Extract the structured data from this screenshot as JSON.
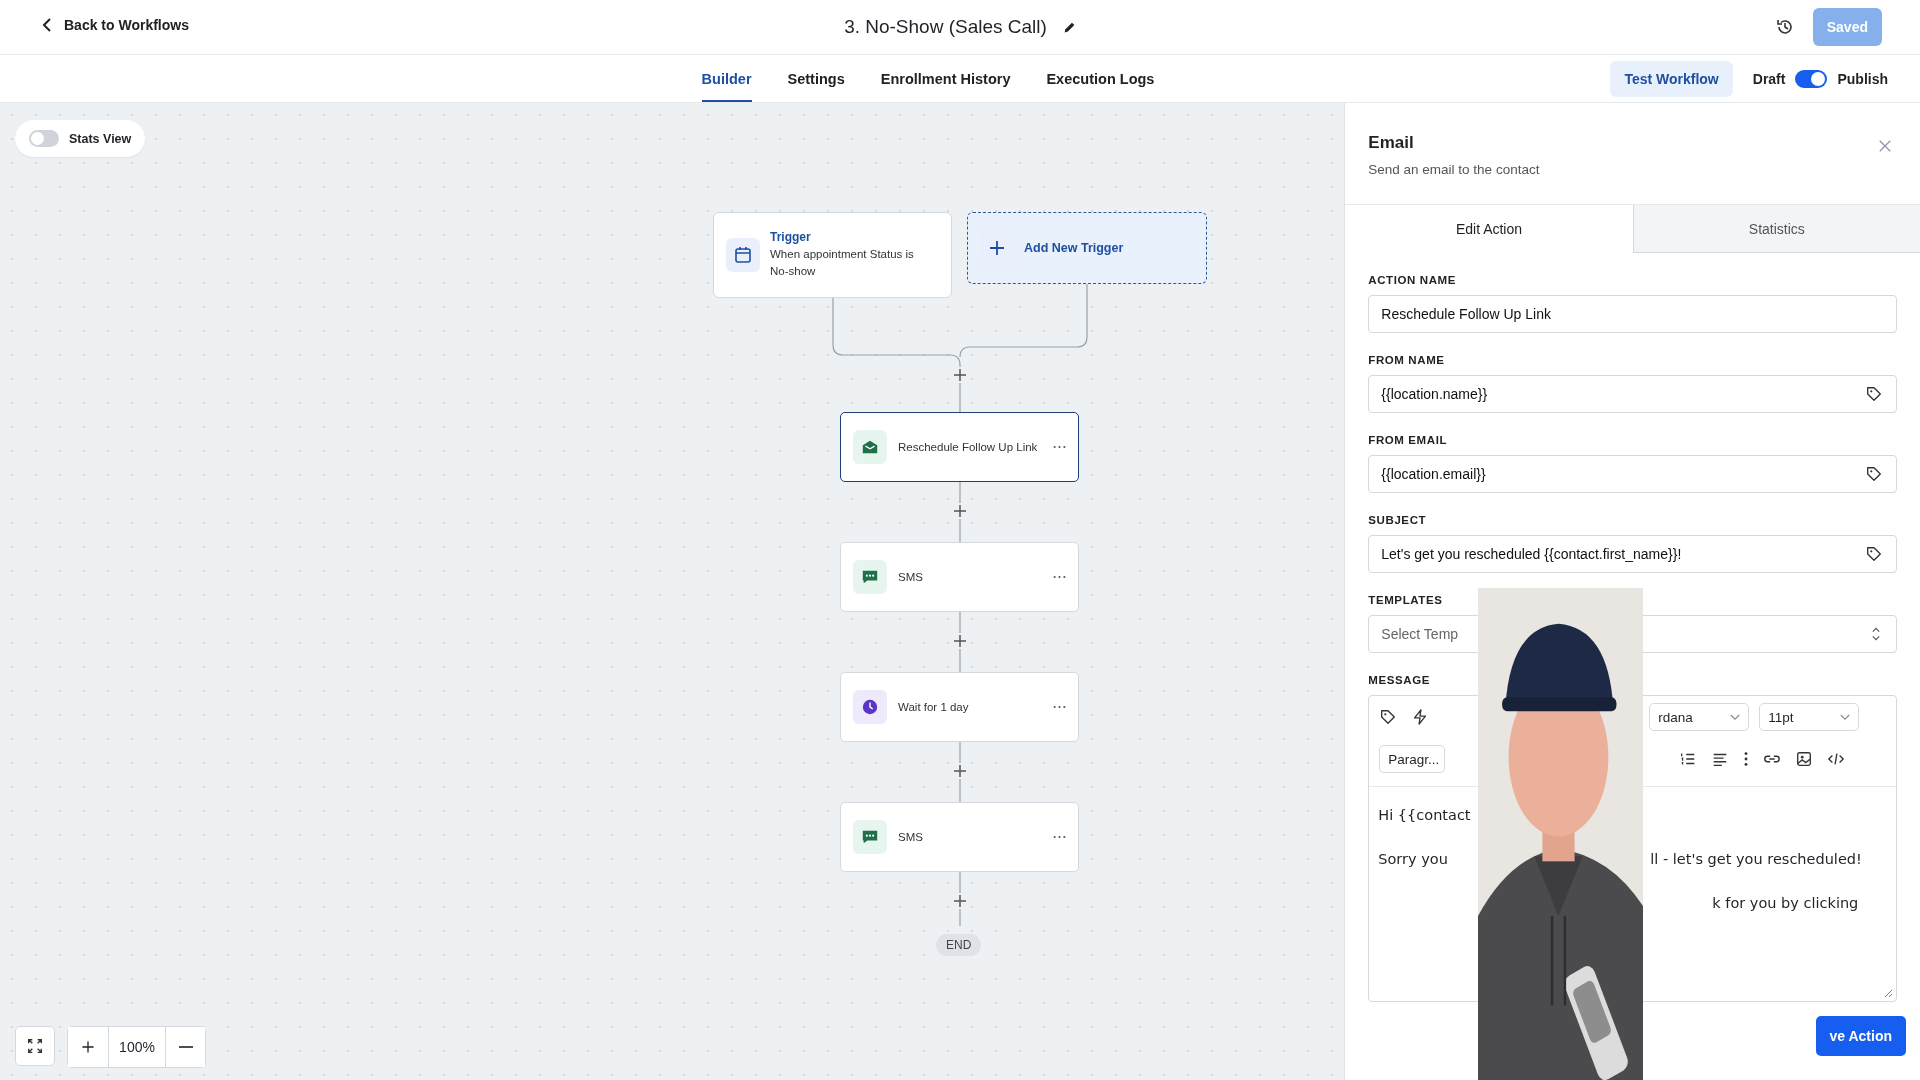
{
  "header": {
    "back_link": "Back to Workflows",
    "title": "3. No-Show (Sales Call)",
    "save_button": {
      "label": "Saved",
      "disabled": true
    }
  },
  "tabs": [
    {
      "label": "Builder",
      "selected": true
    },
    {
      "label": "Settings",
      "selected": false
    },
    {
      "label": "Enrollment History",
      "selected": false
    },
    {
      "label": "Execution Logs",
      "selected": false
    }
  ],
  "test_button": "Test Workflow",
  "publish_toggle": {
    "off_label": "Draft",
    "on_label": "Publish",
    "on": true
  },
  "stats_toggle": {
    "label": "Stats View",
    "on": false
  },
  "triggers": [
    {
      "kind": "trigger",
      "title": "Trigger",
      "description": "When appointment Status is No-show"
    },
    {
      "kind": "add",
      "label": "Add New Trigger"
    }
  ],
  "actions": [
    {
      "kind": "email",
      "label": "Reschedule Follow Up Link",
      "selected": true
    },
    {
      "kind": "sms",
      "label": "SMS",
      "selected": false
    },
    {
      "kind": "wait",
      "label": "Wait for 1 day",
      "selected": false
    },
    {
      "kind": "sms",
      "label": "SMS",
      "selected": false
    }
  ],
  "end_label": "END",
  "zoom": {
    "reading": "100%"
  },
  "panel": {
    "title": "Email",
    "subtitle": "Send an email to the contact",
    "tabs": [
      {
        "label": "Edit Action",
        "selected": true
      },
      {
        "label": "Statistics",
        "selected": false
      }
    ],
    "fields": [
      {
        "kind": "text",
        "label": "ACTION NAME",
        "value": "Reschedule Follow Up Link"
      },
      {
        "kind": "tag",
        "label": "FROM NAME",
        "value": "{{location.name}}"
      },
      {
        "kind": "tag",
        "label": "FROM EMAIL",
        "value": "{{location.email}}"
      },
      {
        "kind": "tag",
        "label": "SUBJECT",
        "value": "Let's get you rescheduled {{contact.first_name}}!"
      },
      {
        "kind": "select",
        "label": "TEMPLATES",
        "placeholder": "Select Temp"
      }
    ],
    "message": {
      "label": "MESSAGE",
      "font_select": "rdana",
      "size_select": "11pt",
      "block_select": "Paragr...",
      "lines": [
        {
          "left": "Hi {{contact"
        },
        {
          "left": "Sorry you",
          "right": "ll - let's get you rescheduled!"
        },
        {
          "right": "k for you by clicking"
        }
      ]
    },
    "save_button": "ve Action"
  }
}
